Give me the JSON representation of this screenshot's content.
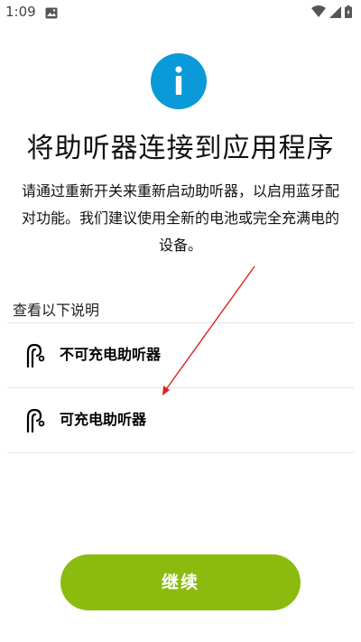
{
  "status_bar": {
    "time": "1:09",
    "icons": [
      "gallery-icon",
      "wifi-icon",
      "signal-icon",
      "battery-charging-icon"
    ]
  },
  "header": {
    "icon": "info-icon",
    "title": "将助听器连接到应用程序",
    "description": "请通过重新开关来重新启动助听器，以启用蓝牙配对功能。我们建议使用全新的电池或完全充满电的设备。"
  },
  "instructions": {
    "label": "查看以下说明",
    "items": [
      {
        "label": "不可充电助听器",
        "icon": "hearing-aid-icon"
      },
      {
        "label": "可充电助听器",
        "icon": "hearing-aid-icon"
      }
    ]
  },
  "footer": {
    "continue_label": "继续"
  },
  "colors": {
    "accent_blue": "#0a9ad9",
    "button_green": "#8cbb0f",
    "annotation_red": "#e02020"
  }
}
